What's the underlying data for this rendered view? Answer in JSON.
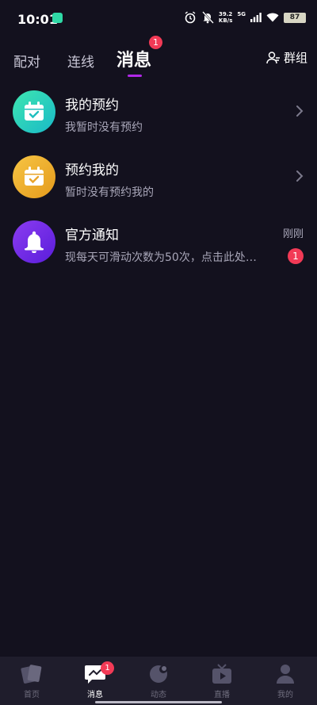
{
  "status_bar": {
    "time": "10:01",
    "net_speed_value": "39.2",
    "net_speed_unit": "KB/s",
    "network": "5G",
    "battery": "87",
    "icons": [
      "alarm-icon",
      "mute-icon",
      "signal-icon",
      "wifi-icon",
      "battery-icon"
    ]
  },
  "top_tabs": {
    "tabs": [
      "配对",
      "连线",
      "消息"
    ],
    "active_index": 2,
    "active_badge": "1",
    "group_label": "群组"
  },
  "messages": [
    {
      "title": "我的预约",
      "subtitle": "我暂时没有预约",
      "icon": "calendar-check-icon",
      "color": "#2fd9b0"
    },
    {
      "title": "预约我的",
      "subtitle": "暂时没有预约我的",
      "icon": "calendar-check-icon",
      "color": "#f0b232"
    },
    {
      "title": "官方通知",
      "subtitle": "现每天可滑动次数为50次，点击此处…",
      "icon": "bell-icon",
      "color": "#7a2ef0",
      "time": "刚刚",
      "badge": "1"
    }
  ],
  "bottom_nav": {
    "items": [
      {
        "label": "首页",
        "icon": "cards-icon"
      },
      {
        "label": "消息",
        "icon": "chat-icon",
        "badge": "1",
        "active": true
      },
      {
        "label": "动态",
        "icon": "moon-icon"
      },
      {
        "label": "直播",
        "icon": "tv-icon"
      },
      {
        "label": "我的",
        "icon": "person-icon"
      }
    ]
  },
  "colors": {
    "background": "#13111e",
    "accent": "#b028e8",
    "badge": "#f23a56",
    "nav_background": "#1f1d2c"
  }
}
